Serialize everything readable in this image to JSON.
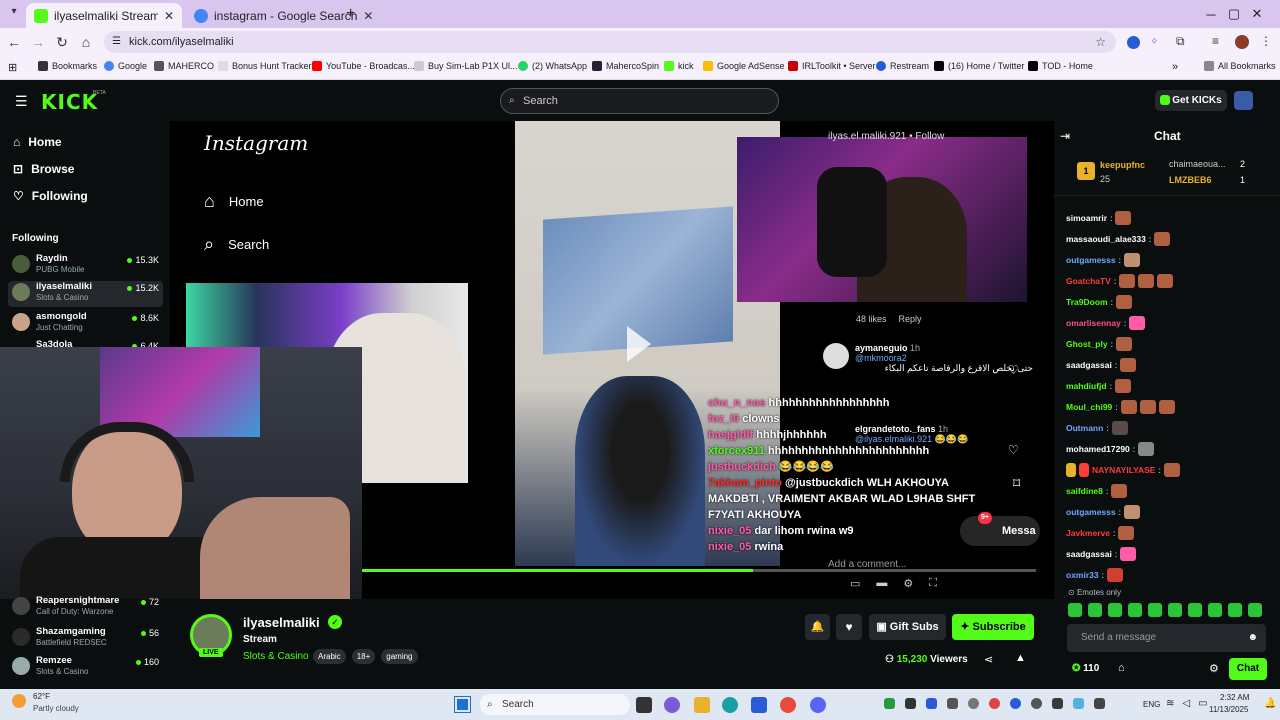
{
  "browser": {
    "tabs": [
      {
        "title": "ilyaselmaliki Stream - Watch",
        "active": true
      },
      {
        "title": "instagram - Google Search",
        "active": false
      }
    ],
    "url": "kick.com/ilyaselmaliki",
    "bookmarks": [
      "Bookmarks",
      "Google",
      "MAHERCO",
      "Bonus Hunt Tracker",
      "YouTube - Broadcas...",
      "Buy Sim-Lab P1X Ul...",
      "(2) WhatsApp",
      "MahercoSpin",
      "kick",
      "Google AdSense",
      "IRLToolkit • Server",
      "Restream",
      "(16) Home / Twitter",
      "TOD - Home"
    ],
    "all_bookmarks": "All Bookmarks"
  },
  "kick": {
    "logo": "KICK",
    "beta": "BETA",
    "search_placeholder": "Search",
    "get_kicks": "Get KICKs"
  },
  "sidebar": {
    "nav": [
      "Home",
      "Browse",
      "Following"
    ],
    "following_header": "Following",
    "channels": [
      {
        "name": "Raydin",
        "category": "PUBG Mobile",
        "viewers": "15.3K"
      },
      {
        "name": "ilyaselmaliki",
        "category": "Slots & Casino",
        "viewers": "15.2K"
      },
      {
        "name": "asmongold",
        "category": "Just Chatting",
        "viewers": "8.6K"
      },
      {
        "name": "Sa3dola",
        "category": "",
        "viewers": "6.4K"
      }
    ],
    "channels_bottom": [
      {
        "name": "Reapersnightmare",
        "category": "Call of Duty: Warzone",
        "viewers": "72"
      },
      {
        "name": "Shazamgaming",
        "category": "Battlefield REDSEC",
        "viewers": "56"
      },
      {
        "name": "Remzee",
        "category": "Slots & Casino",
        "viewers": "160"
      }
    ]
  },
  "stream": {
    "instagram_logo": "Instagram",
    "ig_nav": [
      "Home",
      "Search"
    ],
    "ig_user": "ilyas.el.maliki.921 • Follow",
    "reply_meta": {
      "likes": "48 likes",
      "reply": "Reply"
    },
    "comments": [
      {
        "user": "aymaneguio",
        "time": "1h",
        "mention": "@mkmoora2",
        "text": "حتى يخلص الاقرع والرقاصة تاعكم البكاء"
      },
      {
        "user": "elgrandetoto._fans",
        "time": "1h",
        "mention": "@ilyas.elmaliki.921",
        "text": "😂😂😂"
      }
    ],
    "add_comment": "Add a comment...",
    "message": "Messa",
    "badge": "9+",
    "overlay_chat": [
      {
        "user": "chu_n_nas",
        "text": "hhhhhhhhhhhhhhhhhh",
        "color": "#ff5ca8"
      },
      {
        "user": "foz_i0",
        "text": "clowns",
        "color": "#ff5ca8"
      },
      {
        "user": "hasjgldlf",
        "text": "hhhhjhhhhhh",
        "color": "#ff5ca8"
      },
      {
        "user": "xforcex911",
        "text": "hhhhhhhhhhhhhhhhhhhhhhhh",
        "color": "#53fc18"
      },
      {
        "user": "justbuckdich",
        "text": "😂😂😂😂",
        "color": "#ff5ca8"
      },
      {
        "user": "7akham_pinto",
        "text": "@justbuckdich WLH AKHOUYA MAKDBTI , VRAIMENT AKBAR WLAD L9HAB SHFT F7YATI AKHOUYA",
        "color": "#ff2a2a"
      },
      {
        "user": "nixie_05",
        "text": "dar lihom rwina w9",
        "color": "#ff5ca8"
      },
      {
        "user": "nixie_05",
        "text": "rwina",
        "color": "#ff5ca8"
      }
    ]
  },
  "channel": {
    "name": "ilyaselmaliki",
    "live": "LIVE",
    "title": "Stream",
    "category": "Slots & Casino",
    "tags": [
      "Arabic",
      "18+",
      "gaming"
    ],
    "gift_subs": "Gift Subs",
    "subscribe": "Subscribe",
    "viewers": "15,230",
    "viewers_label": "Viewers"
  },
  "chat": {
    "title": "Chat",
    "leaderboard": [
      {
        "rank": "1",
        "name": "keepupfnc",
        "score": "25"
      },
      {
        "name": "chaimaeoua...",
        "score": "2"
      },
      {
        "name": "LMZBEB6",
        "score": "1"
      }
    ],
    "messages": [
      {
        "user": "simoamrir",
        "color": "#ffffff",
        "text": ""
      },
      {
        "user": "massaoudi_alae333",
        "color": "#ffffff",
        "text": ""
      },
      {
        "user": "outgamesss",
        "color": "#6fa8ff",
        "text": ""
      },
      {
        "user": "GoatchaTV",
        "color": "#ff3b3b",
        "text": ""
      },
      {
        "user": "Tra9Doom",
        "color": "#53fc18",
        "text": ""
      },
      {
        "user": "omarlisennay",
        "color": "#ff4f8a",
        "text": ""
      },
      {
        "user": "Ghost_ply",
        "color": "#53fc18",
        "text": ""
      },
      {
        "user": "saadgassai",
        "color": "#ffffff",
        "text": ""
      },
      {
        "user": "mahdiufjd",
        "color": "#53fc18",
        "text": ""
      },
      {
        "user": "Moul_chi99",
        "color": "#53fc18",
        "text": ""
      },
      {
        "user": "Outmann",
        "color": "#6fa8ff",
        "text": ""
      },
      {
        "user": "mohamed17290",
        "color": "#ffffff",
        "text": ""
      },
      {
        "user": "NAYNAYILYASE",
        "color": "#ff3b3b",
        "text": ""
      },
      {
        "user": "saifdine8",
        "color": "#53fc18",
        "text": ""
      },
      {
        "user": "outgamesss",
        "color": "#6fa8ff",
        "text": ""
      },
      {
        "user": "Javkmerve",
        "color": "#ff3b3b",
        "text": ""
      },
      {
        "user": "saadgassai",
        "color": "#ffffff",
        "text": ""
      },
      {
        "user": "oxmir33",
        "color": "#6fa8ff",
        "text": ""
      }
    ],
    "emotes_only": "Emotes only",
    "send_placeholder": "Send a message",
    "points": "110",
    "chat_button": "Chat"
  },
  "taskbar": {
    "weather_temp": "62°F",
    "weather_desc": "Partly cloudy",
    "search": "Search",
    "lang": "ENG",
    "time": "2:32 AM",
    "date": "11/13/2025"
  }
}
